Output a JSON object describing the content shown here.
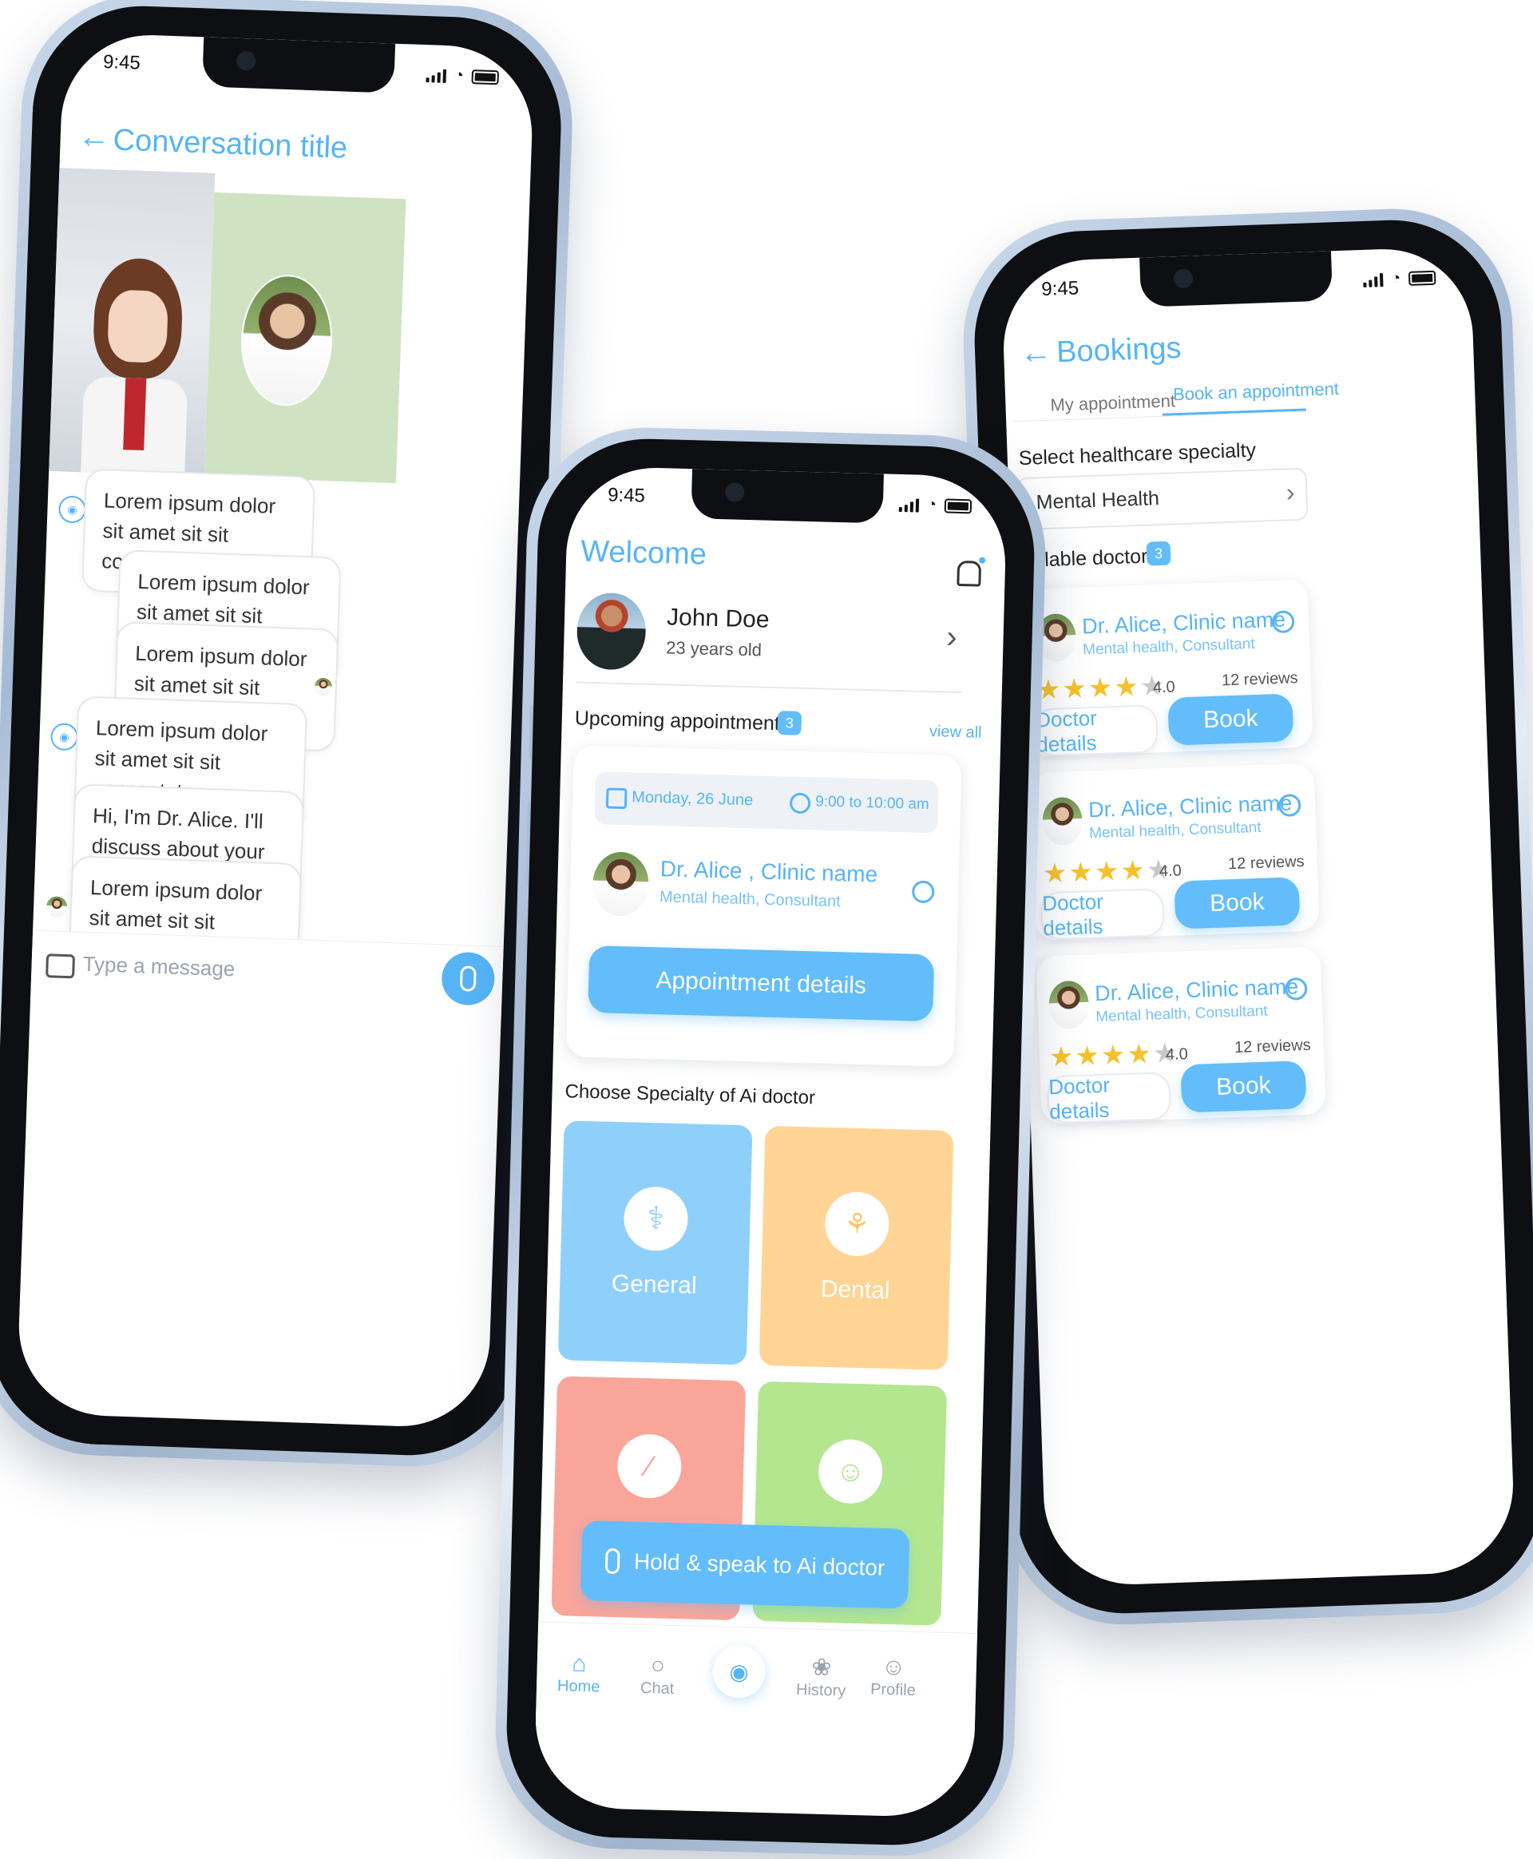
{
  "status_time": "9:45",
  "chat": {
    "title": "Conversation title",
    "messages": [
      {
        "text": "Lorem ipsum dolor sit amet sit sit consectetur.",
        "from": "bot"
      },
      {
        "text": "Lorem ipsum dolor sit amet sit sit consectetur.",
        "from": "user"
      },
      {
        "text": "Lorem ipsum dolor sit amet sit sit consectetur.",
        "from": "user"
      },
      {
        "text": "Lorem ipsum dolor sit amet sit sit consectetur.",
        "from": "bot"
      },
      {
        "text": "Hi, I'm Dr. Alice. I'll discuss about your health issues from here.",
        "from": "bot"
      },
      {
        "text": "Lorem ipsum dolor sit amet sit sit consectetur.",
        "from": "bot"
      }
    ],
    "input_placeholder": "Type a message"
  },
  "home": {
    "welcome": "Welcome",
    "user": {
      "name": "John Doe",
      "age": "23 years old"
    },
    "upcoming": {
      "label": "Upcoming appointment",
      "count": "3",
      "view_all": "view all"
    },
    "appointment": {
      "date": "Monday, 26 June",
      "time": "9:00 to 10:00 am",
      "doctor": "Dr. Alice , Clinic name",
      "specialty": "Mental health, Consultant",
      "button": "Appointment details"
    },
    "specialty_heading": "Choose Specialty of Ai doctor",
    "tiles": [
      {
        "label": "General",
        "color": "#8fd0fb"
      },
      {
        "label": "Dental",
        "color": "#ffd494"
      },
      {
        "label": "",
        "color": "#f9a59a"
      },
      {
        "label": "",
        "color": "#b3e68f"
      }
    ],
    "hold_button": "Hold & speak to Ai doctor",
    "nav": {
      "home": "Home",
      "chat": "Chat",
      "history": "History",
      "profile": "Profile"
    }
  },
  "bookings": {
    "title": "Bookings",
    "tabs": {
      "mine": "My appointment",
      "book": "Book an appointment"
    },
    "select_label": "Select healthcare specialty",
    "selected_specialty": "Mental Health",
    "available_label": "vailable doctors",
    "available_count": "3",
    "doctors": [
      {
        "name": "Dr. Alice, Clinic name",
        "specialty": "Mental health, Consultant",
        "rating": "4.0",
        "reviews": "12 reviews",
        "details": "Doctor details",
        "book": "Book"
      },
      {
        "name": "Dr. Alice, Clinic name",
        "specialty": "Mental health, Consultant",
        "rating": "4.0",
        "reviews": "12 reviews",
        "details": "Doctor details",
        "book": "Book"
      },
      {
        "name": "Dr. Alice, Clinic name",
        "specialty": "Mental health, Consultant",
        "rating": "4.0",
        "reviews": "12 reviews",
        "details": "Doctor details",
        "book": "Book"
      }
    ]
  },
  "colors": {
    "accent": "#56b4f5",
    "button": "#62bdfa",
    "star": "#f5c12a"
  }
}
